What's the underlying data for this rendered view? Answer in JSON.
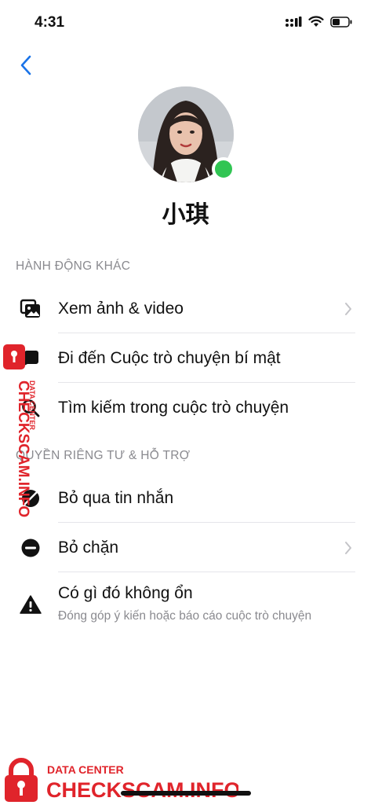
{
  "status_bar": {
    "time": "4:31"
  },
  "profile": {
    "name": "小琪",
    "online_color": "#31c553"
  },
  "sections": {
    "more_actions": {
      "header": "HÀNH ĐỘNG KHÁC",
      "items": [
        {
          "label": "Xem ảnh & video",
          "icon": "photos-icon",
          "chevron": true
        },
        {
          "label": "Đi đến Cuộc trò chuyện bí mật",
          "icon": "secret-chat-icon",
          "chevron": false
        },
        {
          "label": "Tìm kiếm trong cuộc trò chuyện",
          "icon": "search-icon",
          "chevron": false
        }
      ]
    },
    "privacy": {
      "header": "QUYỀN RIÊNG TƯ & HỖ TRỢ",
      "items": [
        {
          "label": "Bỏ qua tin nhắn",
          "icon": "ignore-icon",
          "chevron": false
        },
        {
          "label": "Bỏ chặn",
          "icon": "unblock-icon",
          "chevron": true
        },
        {
          "label": "Có gì đó không ổn",
          "sublabel": "Đóng góp ý kiến hoặc báo cáo cuộc trò chuyện",
          "icon": "warning-icon",
          "chevron": false
        }
      ]
    }
  },
  "watermark": {
    "side_top": "DATA CENTER",
    "side_main": "CHECKSCAM.INFO",
    "bottom_top": "DATA CENTER",
    "bottom_main": "CHECKSCAM.INFO",
    "color": "#e0242b"
  }
}
